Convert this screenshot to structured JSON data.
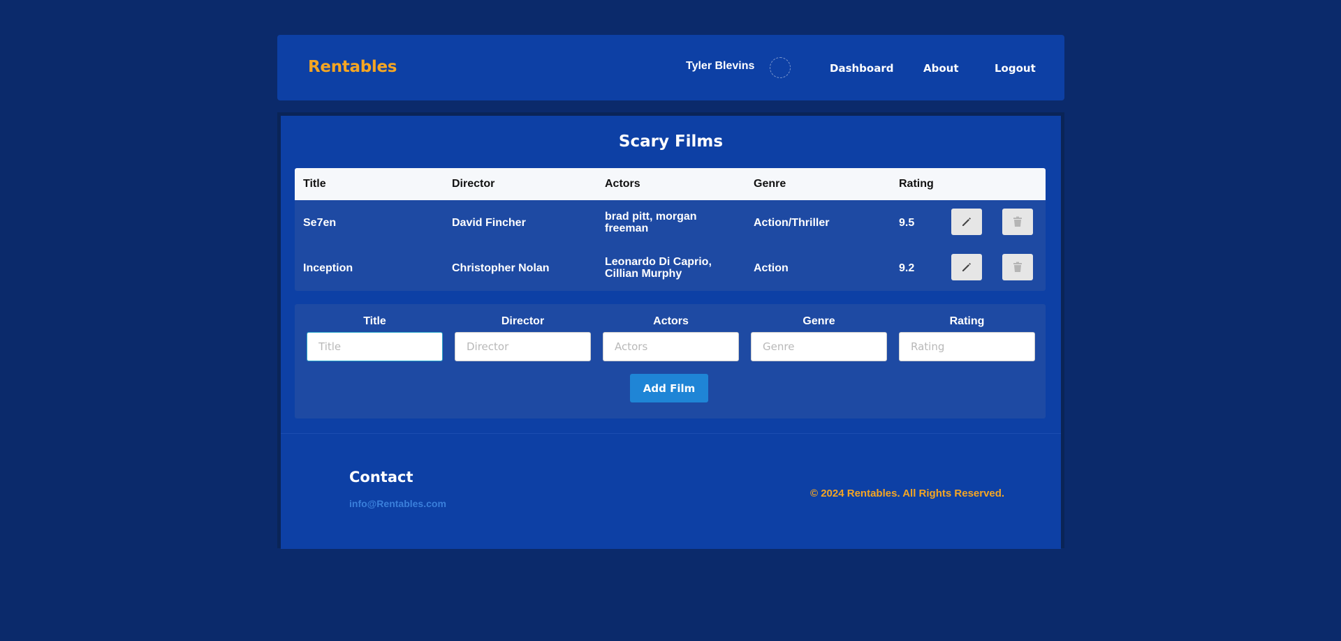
{
  "navbar": {
    "brand": "Rentables",
    "user_name": "Tyler Blevins",
    "links": {
      "dashboard": "Dashboard",
      "about": "About",
      "logout": "Logout"
    }
  },
  "main": {
    "title": "Scary Films",
    "table": {
      "headers": {
        "title": "Title",
        "director": "Director",
        "actors": "Actors",
        "genre": "Genre",
        "rating": "Rating"
      },
      "rows": [
        {
          "title": "Se7en",
          "director": "David Fincher",
          "actors": "brad pitt, morgan freeman",
          "genre": "Action/Thriller",
          "rating": "9.5"
        },
        {
          "title": "Inception",
          "director": "Christopher Nolan",
          "actors": "Leonardo Di Caprio, Cillian Murphy",
          "genre": "Action",
          "rating": "9.2"
        }
      ]
    },
    "form": {
      "fields": {
        "title": {
          "label": "Title",
          "placeholder": "Title",
          "value": ""
        },
        "director": {
          "label": "Director",
          "placeholder": "Director",
          "value": ""
        },
        "actors": {
          "label": "Actors",
          "placeholder": "Actors",
          "value": ""
        },
        "genre": {
          "label": "Genre",
          "placeholder": "Genre",
          "value": ""
        },
        "rating": {
          "label": "Rating",
          "placeholder": "Rating",
          "value": ""
        }
      },
      "submit_label": "Add Film"
    }
  },
  "footer": {
    "contact_title": "Contact",
    "email": "info@Rentables.com",
    "copyright": "© 2024 Rentables. All Rights Reserved."
  },
  "colors": {
    "page_bg": "#0b2a6b",
    "panel_bg": "#0d40a5",
    "brand": "#f5a623",
    "accent_button": "#1f85d6",
    "email_link": "#3a7fdb"
  },
  "icons": {
    "edit": "pencil-icon",
    "delete": "trash-icon"
  }
}
